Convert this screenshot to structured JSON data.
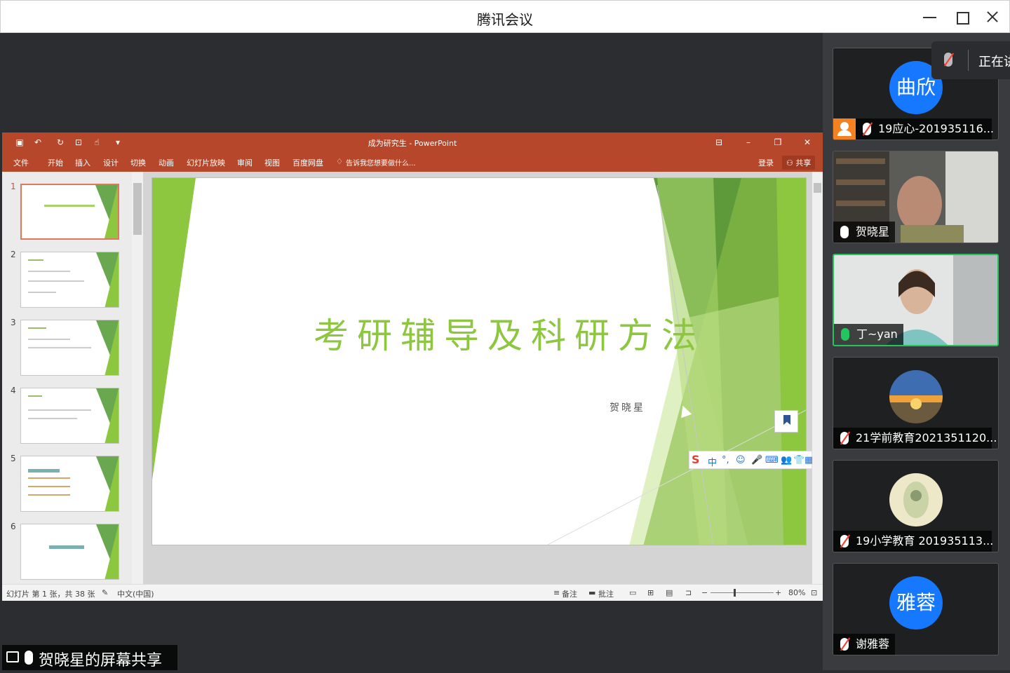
{
  "window": {
    "title": "腾讯会议"
  },
  "powerpoint": {
    "doc_title": "成为研究生 - PowerPoint",
    "ribbon_tabs": [
      "文件",
      "开始",
      "插入",
      "设计",
      "切换",
      "动画",
      "幻灯片放映",
      "审阅",
      "视图",
      "百度网盘",
      "告诉我您想要做什么..."
    ],
    "login": "登录",
    "share": "共享",
    "thumbnails": [
      "1",
      "2",
      "3",
      "4",
      "5",
      "6"
    ],
    "slide": {
      "title": "考研辅导及科研方法",
      "author": "贺晓星"
    },
    "ime": [
      "中",
      "°,",
      "☺",
      "🎤",
      "⌨",
      "👥",
      "👕",
      "▦"
    ],
    "status": {
      "slide_info": "幻灯片 第 1 张，共 38 张",
      "language": "中文(中国)",
      "notes": "备注",
      "comments": "批注",
      "zoom": "80%"
    },
    "accent_color": "#b7472a",
    "slide_green": "#8dc63f"
  },
  "share_label": "贺晓星的屏幕共享",
  "speaking_indicator": "正在讲",
  "participants": [
    {
      "avatar_text": "曲欣",
      "name": "19应心-201935116...",
      "muted": true
    },
    {
      "name": "贺晓星",
      "muted": false
    },
    {
      "name": "丁~yan",
      "muted": false,
      "speaking": true
    },
    {
      "name": "21学前教育2021351120...",
      "muted": true
    },
    {
      "name": "19小学教育 201935113...",
      "muted": true
    },
    {
      "avatar_text": "雅蓉",
      "name": "谢雅蓉",
      "muted": true
    }
  ]
}
